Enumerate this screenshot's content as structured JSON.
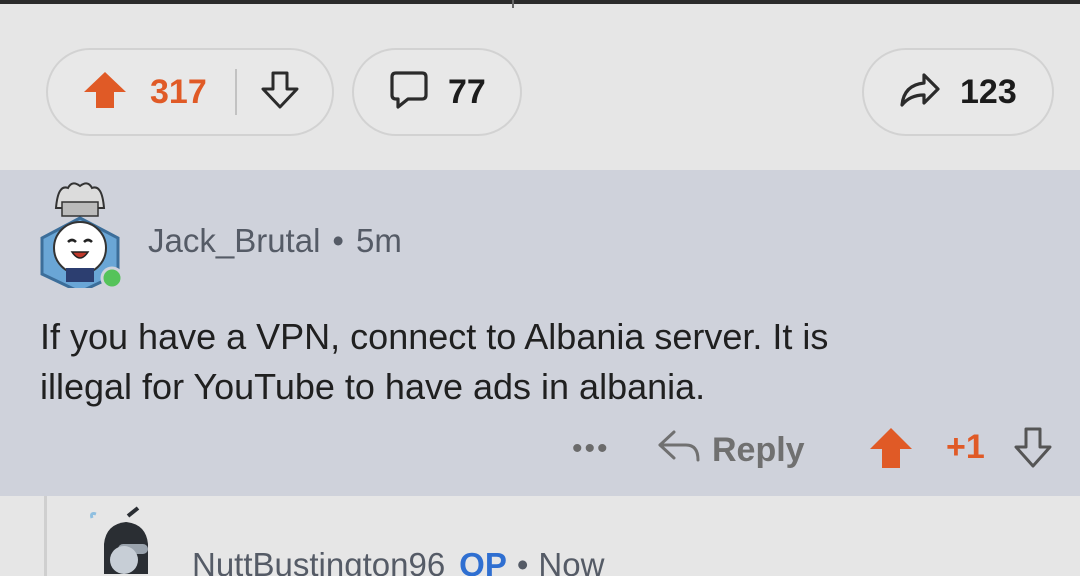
{
  "post_actions": {
    "score": "317",
    "comments": "77",
    "shares": "123"
  },
  "comment": {
    "username": "Jack_Brutal",
    "separator": "•",
    "time": "5m",
    "text_line1": "If you have a VPN, connect to Albania server.  It is",
    "text_line2": "illegal for YouTube to have ads in albania.",
    "more": "•••",
    "reply_label": "Reply",
    "score": "+1"
  },
  "reply": {
    "username": "NuttBustington96",
    "badge": "OP",
    "separator": "•",
    "time": "Now"
  },
  "colors": {
    "upvote": "#e05a26",
    "op_badge": "#2f6fd1",
    "comment_bg": "#cfd2db"
  }
}
